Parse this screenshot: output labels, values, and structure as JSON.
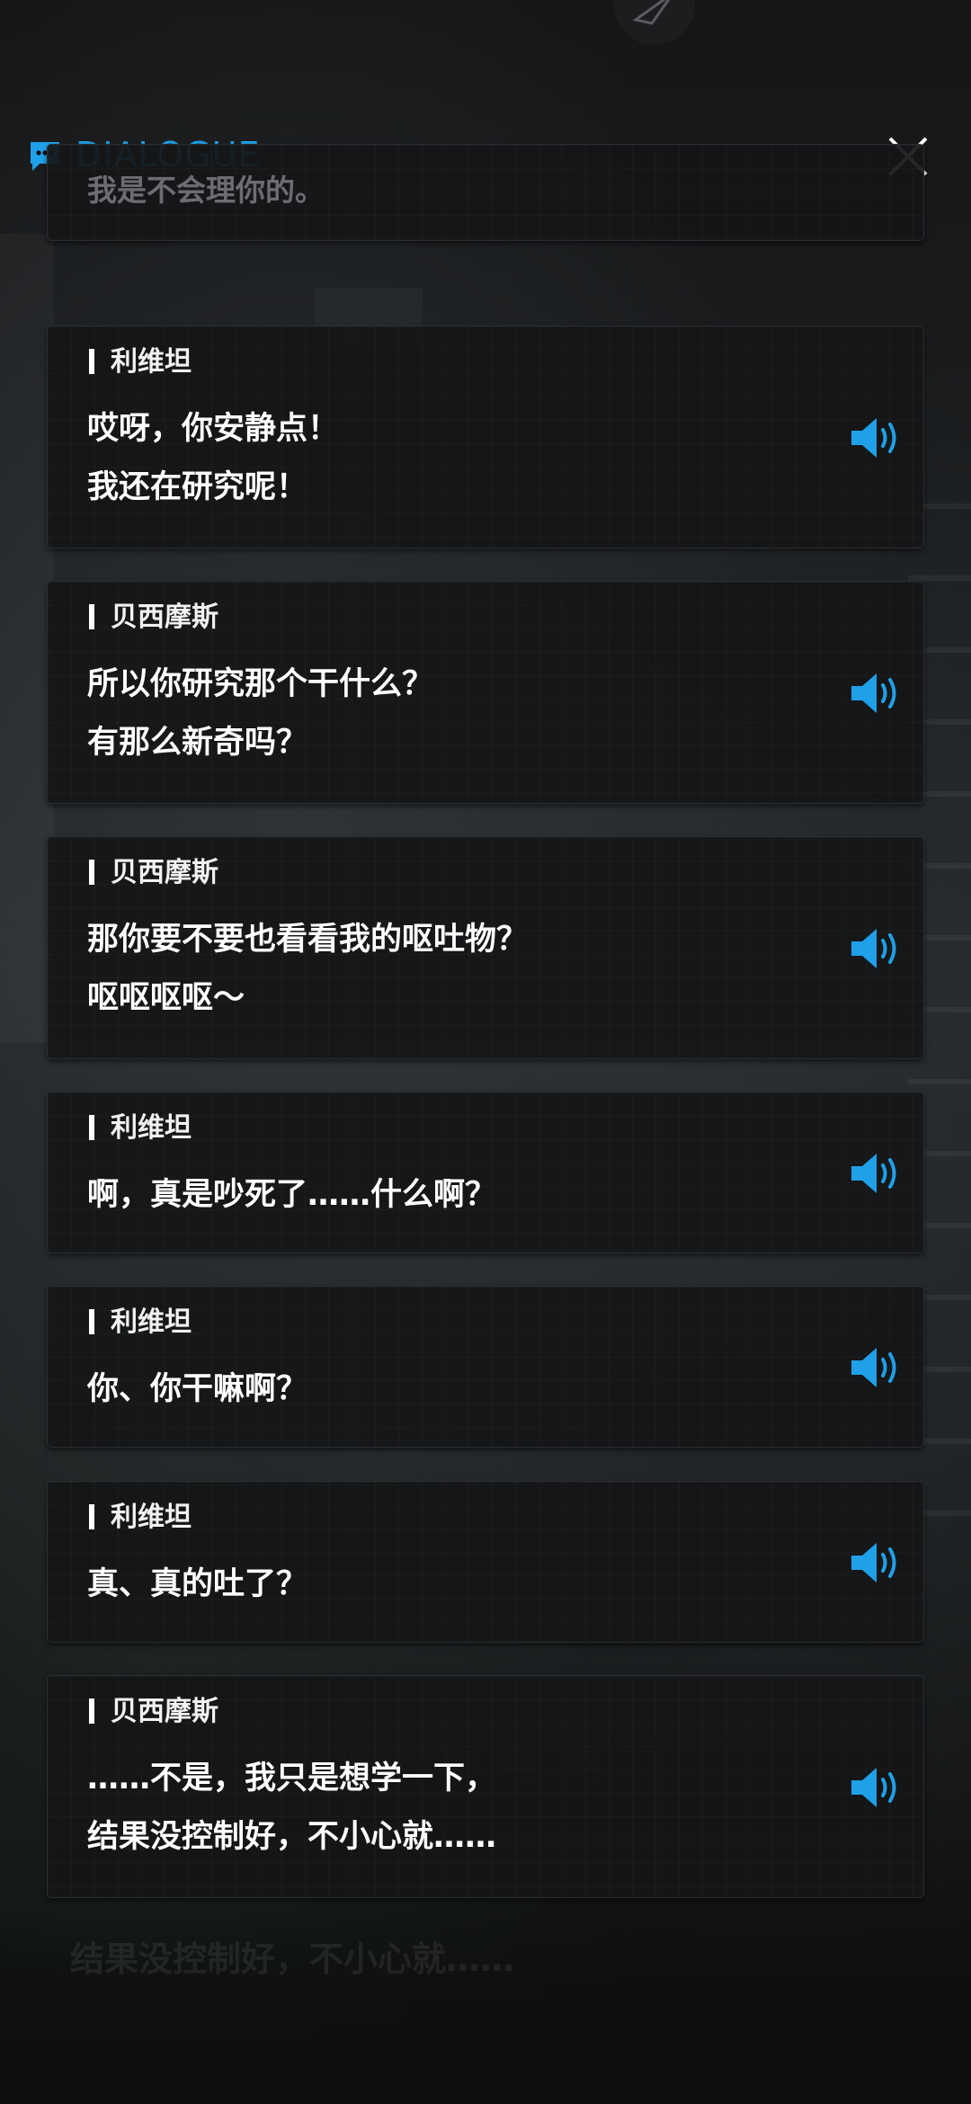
{
  "header": {
    "title": "DIALOGUE",
    "accent_color": "#1fa0e8",
    "icon": "chat-bubble-icon",
    "close_icon": "close-icon"
  },
  "partial_card": {
    "text": "我是不会理你的。"
  },
  "dialogues": [
    {
      "speaker": "利维坦",
      "lines": [
        "哎呀，你安静点！",
        "我还在研究呢！"
      ]
    },
    {
      "speaker": "贝西摩斯",
      "lines": [
        "所以你研究那个干什么？",
        "有那么新奇吗？"
      ]
    },
    {
      "speaker": "贝西摩斯",
      "lines": [
        "那你要不要也看看我的呕吐物？",
        "呕呕呕呕〜"
      ]
    },
    {
      "speaker": "利维坦",
      "lines": [
        "啊，真是吵死了……什么啊？"
      ]
    },
    {
      "speaker": "利维坦",
      "lines": [
        "你、你干嘛啊？"
      ]
    },
    {
      "speaker": "利维坦",
      "lines": [
        "真、真的吐了？"
      ]
    },
    {
      "speaker": "贝西摩斯",
      "lines": [
        "……不是，我只是想学一下，",
        "结果没控制好，不小心就……"
      ]
    }
  ],
  "voice_icon": "speaker-volume-icon",
  "background_subtitle": "结果没控制好，不小心就……"
}
